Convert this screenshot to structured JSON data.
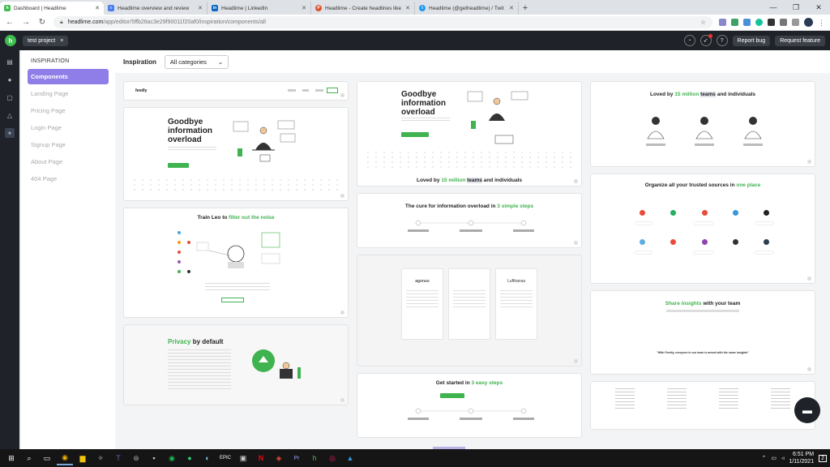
{
  "browser": {
    "tabs": [
      {
        "label": "Dashboard | Headlime",
        "icon": "headlime-icon",
        "color": "#3fbd4f",
        "active": true
      },
      {
        "label": "Headlime overview and review",
        "icon": "docs-icon",
        "color": "#4a7df0",
        "active": false
      },
      {
        "label": "Headlime | LinkedIn",
        "icon": "linkedin-icon",
        "color": "#0a66c2",
        "active": false
      },
      {
        "label": "Headlime - Create headlines like",
        "icon": "producthunt-icon",
        "color": "#da552f",
        "active": false
      },
      {
        "label": "Headlime (@getheadlime) / Twit",
        "icon": "twitter-icon",
        "color": "#1d9bf0",
        "active": false
      }
    ],
    "new_tab": "+",
    "url_domain": "headlime.com",
    "url_path": "/app/editor/5ffb26ac3e29f90011f20af0/inspiration/components/all"
  },
  "app": {
    "project_tab": "test project",
    "project_close": "×",
    "report_bug": "Report bug",
    "request_feature": "Request feature"
  },
  "sidebar": {
    "section": "INSPIRATION",
    "items": [
      {
        "label": "Components",
        "active": true
      },
      {
        "label": "Landing Page"
      },
      {
        "label": "Pricing Page"
      },
      {
        "label": "Login Page"
      },
      {
        "label": "Signup Page"
      },
      {
        "label": "About Page"
      },
      {
        "label": "404 Page"
      }
    ]
  },
  "main": {
    "filter_label": "Inspiration",
    "category_select": "All categories",
    "cards": {
      "nav_brand": "feedly",
      "hero1_title": "Goodbye information overload",
      "hero2_title": "Goodbye information overload",
      "loved_prefix": "Loved by ",
      "loved_highlight": "15 million",
      "loved_teams": "teams",
      "loved_suffix": " and individuals",
      "train_prefix": "Train Leo to ",
      "train_highlight": "filter out the noise",
      "cure_prefix": "The cure for information overload in ",
      "cure_highlight": "3 simple steps",
      "organize_prefix": "Organize all your trusted sources in ",
      "organize_highlight": "one place",
      "privacy_highlight": "Privacy",
      "privacy_suffix": " by default",
      "share_highlight": "Share insights",
      "share_suffix": " with your team",
      "share_quote": "\"With Feedly, everyone in our team is armed with the same insights\"",
      "started_prefix": "Get started in ",
      "started_highlight": "3 easy steps",
      "testimonial_brand1": "agenus",
      "testimonial_brand3": "Lufthansa"
    }
  },
  "taskbar": {
    "time": "6:51 PM",
    "date": "1/11/2021",
    "notifications": "2"
  }
}
